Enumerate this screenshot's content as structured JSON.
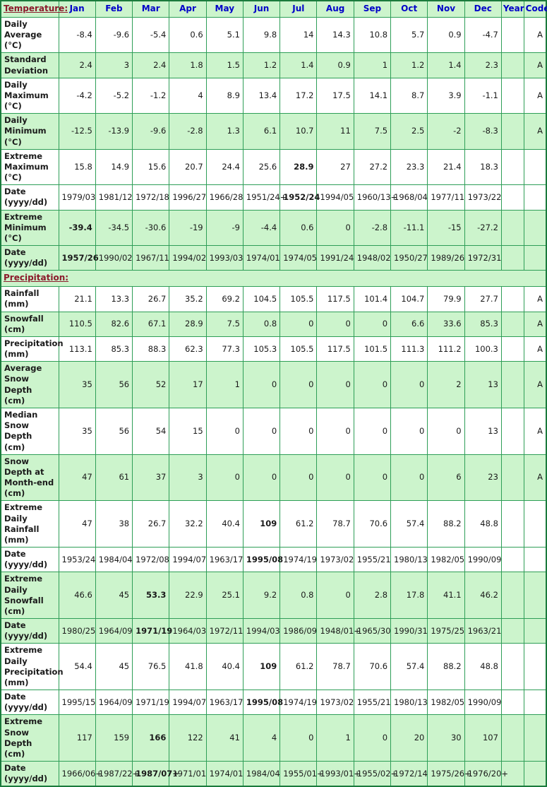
{
  "columns": [
    "Jan",
    "Feb",
    "Mar",
    "Apr",
    "May",
    "Jun",
    "Jul",
    "Aug",
    "Sep",
    "Oct",
    "Nov",
    "Dec",
    "Year",
    "Code"
  ],
  "sections": {
    "temperature_label": "Temperature:",
    "precipitation_label": "Precipitation:"
  },
  "rows": [
    {
      "label": "Daily Average (°C)",
      "shade": "white",
      "values": [
        "-8.4",
        "-9.6",
        "-5.4",
        "0.6",
        "5.1",
        "9.8",
        "14",
        "14.3",
        "10.8",
        "5.7",
        "0.9",
        "-4.7",
        "",
        "A"
      ],
      "bold": [
        false,
        false,
        false,
        false,
        false,
        false,
        false,
        false,
        false,
        false,
        false,
        false,
        false,
        false
      ]
    },
    {
      "label": "Standard Deviation",
      "shade": "green",
      "values": [
        "2.4",
        "3",
        "2.4",
        "1.8",
        "1.5",
        "1.2",
        "1.4",
        "0.9",
        "1",
        "1.2",
        "1.4",
        "2.3",
        "",
        "A"
      ],
      "bold": [
        false,
        false,
        false,
        false,
        false,
        false,
        false,
        false,
        false,
        false,
        false,
        false,
        false,
        false
      ]
    },
    {
      "label": "Daily Maximum (°C)",
      "shade": "white",
      "values": [
        "-4.2",
        "-5.2",
        "-1.2",
        "4",
        "8.9",
        "13.4",
        "17.2",
        "17.5",
        "14.1",
        "8.7",
        "3.9",
        "-1.1",
        "",
        "A"
      ],
      "bold": [
        false,
        false,
        false,
        false,
        false,
        false,
        false,
        false,
        false,
        false,
        false,
        false,
        false,
        false
      ]
    },
    {
      "label": "Daily Minimum (°C)",
      "shade": "green",
      "values": [
        "-12.5",
        "-13.9",
        "-9.6",
        "-2.8",
        "1.3",
        "6.1",
        "10.7",
        "11",
        "7.5",
        "2.5",
        "-2",
        "-8.3",
        "",
        "A"
      ],
      "bold": [
        false,
        false,
        false,
        false,
        false,
        false,
        false,
        false,
        false,
        false,
        false,
        false,
        false,
        false
      ]
    },
    {
      "label": "Extreme Maximum (°C)",
      "shade": "white",
      "values": [
        "15.8",
        "14.9",
        "15.6",
        "20.7",
        "24.4",
        "25.6",
        "28.9",
        "27",
        "27.2",
        "23.3",
        "21.4",
        "18.3",
        "",
        ""
      ],
      "bold": [
        false,
        false,
        false,
        false,
        false,
        false,
        true,
        false,
        false,
        false,
        false,
        false,
        false,
        false
      ]
    },
    {
      "label": "Date (yyyy/dd)",
      "shade": "white",
      "values": [
        "1979/03",
        "1981/12",
        "1972/18",
        "1996/27",
        "1966/28",
        "1951/24+",
        "1952/24",
        "1994/05",
        "1960/13+",
        "1968/04",
        "1977/11",
        "1973/22",
        "",
        ""
      ],
      "bold": [
        false,
        false,
        false,
        false,
        false,
        false,
        true,
        false,
        false,
        false,
        false,
        false,
        false,
        false
      ]
    },
    {
      "label": "Extreme Minimum (°C)",
      "shade": "green",
      "values": [
        "-39.4",
        "-34.5",
        "-30.6",
        "-19",
        "-9",
        "-4.4",
        "0.6",
        "0",
        "-2.8",
        "-11.1",
        "-15",
        "-27.2",
        "",
        ""
      ],
      "bold": [
        true,
        false,
        false,
        false,
        false,
        false,
        false,
        false,
        false,
        false,
        false,
        false,
        false,
        false
      ]
    },
    {
      "label": "Date (yyyy/dd)",
      "shade": "green",
      "values": [
        "1957/26",
        "1990/02",
        "1967/11",
        "1994/02",
        "1993/03",
        "1974/01",
        "1974/05",
        "1991/24",
        "1948/02",
        "1950/27",
        "1989/26",
        "1972/31",
        "",
        ""
      ],
      "bold": [
        true,
        false,
        false,
        false,
        false,
        false,
        false,
        false,
        false,
        false,
        false,
        false,
        false,
        false
      ]
    },
    {
      "label": "Rainfall (mm)",
      "shade": "white",
      "values": [
        "21.1",
        "13.3",
        "26.7",
        "35.2",
        "69.2",
        "104.5",
        "105.5",
        "117.5",
        "101.4",
        "104.7",
        "79.9",
        "27.7",
        "",
        "A"
      ],
      "bold": [
        false,
        false,
        false,
        false,
        false,
        false,
        false,
        false,
        false,
        false,
        false,
        false,
        false,
        false
      ]
    },
    {
      "label": "Snowfall (cm)",
      "shade": "green",
      "values": [
        "110.5",
        "82.6",
        "67.1",
        "28.9",
        "7.5",
        "0.8",
        "0",
        "0",
        "0",
        "6.6",
        "33.6",
        "85.3",
        "",
        "A"
      ],
      "bold": [
        false,
        false,
        false,
        false,
        false,
        false,
        false,
        false,
        false,
        false,
        false,
        false,
        false,
        false
      ]
    },
    {
      "label": "Precipitation (mm)",
      "shade": "white",
      "values": [
        "113.1",
        "85.3",
        "88.3",
        "62.3",
        "77.3",
        "105.3",
        "105.5",
        "117.5",
        "101.5",
        "111.3",
        "111.2",
        "100.3",
        "",
        "A"
      ],
      "bold": [
        false,
        false,
        false,
        false,
        false,
        false,
        false,
        false,
        false,
        false,
        false,
        false,
        false,
        false
      ]
    },
    {
      "label": "Average Snow Depth (cm)",
      "shade": "green",
      "values": [
        "35",
        "56",
        "52",
        "17",
        "1",
        "0",
        "0",
        "0",
        "0",
        "0",
        "2",
        "13",
        "",
        "A"
      ],
      "bold": [
        false,
        false,
        false,
        false,
        false,
        false,
        false,
        false,
        false,
        false,
        false,
        false,
        false,
        false
      ]
    },
    {
      "label": "Median Snow Depth (cm)",
      "shade": "white",
      "values": [
        "35",
        "56",
        "54",
        "15",
        "0",
        "0",
        "0",
        "0",
        "0",
        "0",
        "0",
        "13",
        "",
        "A"
      ],
      "bold": [
        false,
        false,
        false,
        false,
        false,
        false,
        false,
        false,
        false,
        false,
        false,
        false,
        false,
        false
      ]
    },
    {
      "label": "Snow Depth at Month-end (cm)",
      "shade": "green",
      "values": [
        "47",
        "61",
        "37",
        "3",
        "0",
        "0",
        "0",
        "0",
        "0",
        "0",
        "6",
        "23",
        "",
        "A"
      ],
      "bold": [
        false,
        false,
        false,
        false,
        false,
        false,
        false,
        false,
        false,
        false,
        false,
        false,
        false,
        false
      ]
    },
    {
      "label": "Extreme Daily Rainfall (mm)",
      "shade": "white",
      "values": [
        "47",
        "38",
        "26.7",
        "32.2",
        "40.4",
        "109",
        "61.2",
        "78.7",
        "70.6",
        "57.4",
        "88.2",
        "48.8",
        "",
        ""
      ],
      "bold": [
        false,
        false,
        false,
        false,
        false,
        true,
        false,
        false,
        false,
        false,
        false,
        false,
        false,
        false
      ]
    },
    {
      "label": "Date (yyyy/dd)",
      "shade": "white",
      "values": [
        "1953/24",
        "1984/04",
        "1972/08",
        "1994/07",
        "1963/17",
        "1995/08",
        "1974/19",
        "1973/02",
        "1955/21",
        "1980/13",
        "1982/05",
        "1990/09",
        "",
        ""
      ],
      "bold": [
        false,
        false,
        false,
        false,
        false,
        true,
        false,
        false,
        false,
        false,
        false,
        false,
        false,
        false
      ]
    },
    {
      "label": "Extreme Daily Snowfall (cm)",
      "shade": "green",
      "values": [
        "46.6",
        "45",
        "53.3",
        "22.9",
        "25.1",
        "9.2",
        "0.8",
        "0",
        "2.8",
        "17.8",
        "41.1",
        "46.2",
        "",
        ""
      ],
      "bold": [
        false,
        false,
        true,
        false,
        false,
        false,
        false,
        false,
        false,
        false,
        false,
        false,
        false,
        false
      ]
    },
    {
      "label": "Date (yyyy/dd)",
      "shade": "green",
      "values": [
        "1980/25",
        "1964/09",
        "1971/19",
        "1964/03",
        "1972/11",
        "1994/03",
        "1986/09",
        "1948/01+",
        "1965/30",
        "1990/31",
        "1975/25",
        "1963/21",
        "",
        ""
      ],
      "bold": [
        false,
        false,
        true,
        false,
        false,
        false,
        false,
        false,
        false,
        false,
        false,
        false,
        false,
        false
      ]
    },
    {
      "label": "Extreme Daily Precipitation (mm)",
      "shade": "white",
      "values": [
        "54.4",
        "45",
        "76.5",
        "41.8",
        "40.4",
        "109",
        "61.2",
        "78.7",
        "70.6",
        "57.4",
        "88.2",
        "48.8",
        "",
        ""
      ],
      "bold": [
        false,
        false,
        false,
        false,
        false,
        true,
        false,
        false,
        false,
        false,
        false,
        false,
        false,
        false
      ]
    },
    {
      "label": "Date (yyyy/dd)",
      "shade": "white",
      "values": [
        "1995/15",
        "1964/09",
        "1971/19",
        "1994/07",
        "1963/17",
        "1995/08",
        "1974/19",
        "1973/02",
        "1955/21",
        "1980/13",
        "1982/05",
        "1990/09",
        "",
        ""
      ],
      "bold": [
        false,
        false,
        false,
        false,
        false,
        true,
        false,
        false,
        false,
        false,
        false,
        false,
        false,
        false
      ]
    },
    {
      "label": "Extreme Snow Depth (cm)",
      "shade": "green",
      "values": [
        "117",
        "159",
        "166",
        "122",
        "41",
        "4",
        "0",
        "1",
        "0",
        "20",
        "30",
        "107",
        "",
        ""
      ],
      "bold": [
        false,
        false,
        true,
        false,
        false,
        false,
        false,
        false,
        false,
        false,
        false,
        false,
        false,
        false
      ]
    },
    {
      "label": "Date (yyyy/dd)",
      "shade": "green",
      "values": [
        "1966/06+",
        "1987/22+",
        "1987/07+",
        "1971/01",
        "1974/01",
        "1984/04",
        "1955/01+",
        "1993/01+",
        "1955/02+",
        "1972/14",
        "1975/26+",
        "1976/20+",
        "",
        ""
      ],
      "bold": [
        false,
        false,
        true,
        false,
        false,
        false,
        false,
        false,
        false,
        false,
        false,
        false,
        false,
        false
      ]
    }
  ],
  "precipitation_section_index": 8
}
